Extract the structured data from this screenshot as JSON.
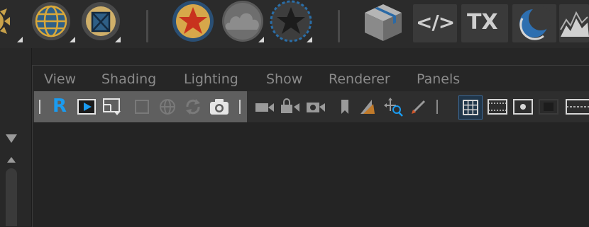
{
  "shelf": {
    "items": [
      {
        "name": "partial-sun",
        "icon": "sun-icon"
      },
      {
        "name": "globe",
        "icon": "globe-icon"
      },
      {
        "name": "box",
        "icon": "crossed-box-icon"
      },
      {
        "name": "star-light",
        "icon": "red-star-icon"
      },
      {
        "name": "cloud",
        "icon": "cloud-icon"
      },
      {
        "name": "dark-star",
        "icon": "dark-star-icon"
      },
      {
        "name": "package",
        "icon": "package-icon"
      },
      {
        "name": "code",
        "label": "</>",
        "icon": "code-icon"
      },
      {
        "name": "tx",
        "label": "TX",
        "icon": "tx-icon"
      },
      {
        "name": "moon",
        "icon": "moon-icon"
      },
      {
        "name": "terrain",
        "icon": "terrain-icon"
      }
    ]
  },
  "panel": {
    "menu": [
      "View",
      "Shading",
      "Lighting",
      "Show",
      "Renderer",
      "Panels"
    ],
    "toolbar": {
      "r_label": "R",
      "icons": [
        "render-view-icon",
        "snapshot-region-icon",
        "disabled-square-icon",
        "disabled-globe-icon",
        "disabled-refresh-icon",
        "camera-icon",
        "video-camera-icon",
        "lock-camera-icon",
        "camera-gear-icon",
        "bookmark-icon",
        "image-plane-icon",
        "move-search-icon",
        "pick-icon",
        "grid-icon",
        "film-gate-icon",
        "resolution-gate-icon",
        "gate-mask-icon",
        "field-chart-icon"
      ]
    }
  },
  "colors": {
    "accent": "#2196f3",
    "shelf_bg": "#2b2b2b",
    "panel_bg": "#262626",
    "menu_text": "#8a8a8a",
    "toolbar_group": "#5f5f5f"
  }
}
